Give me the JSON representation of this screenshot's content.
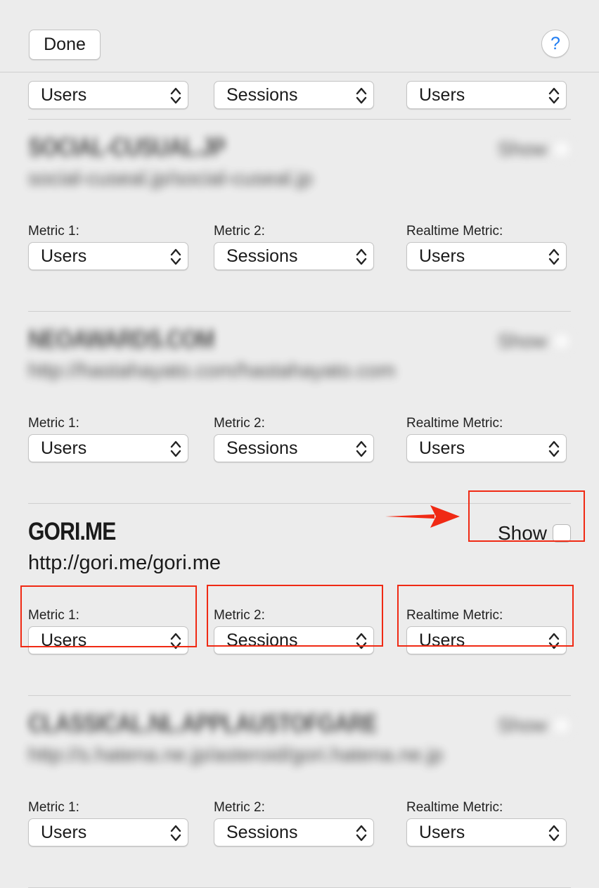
{
  "toolbar": {
    "done_label": "Done",
    "help_label": "?"
  },
  "first_row": {
    "metric1": "Users",
    "metric2": "Sessions",
    "realtime": "Users"
  },
  "labels": {
    "metric1": "Metric 1:",
    "metric2": "Metric 2:",
    "realtime": "Realtime Metric:",
    "show": "Show"
  },
  "sites": [
    {
      "name": "SOCIAL-CUSUAL.JP",
      "url": "social-cuseal.jp/social-cuseal.jp",
      "blurred": true,
      "metric1": "Users",
      "metric2": "Sessions",
      "realtime": "Users",
      "show_checked": false
    },
    {
      "name": "NEOAWARDS.COM",
      "url": "http://hastahayato.com/hastahayato.com",
      "blurred": true,
      "metric1": "Users",
      "metric2": "Sessions",
      "realtime": "Users",
      "show_checked": false
    },
    {
      "name": "GORI.ME",
      "url": "http://gori.me/gori.me",
      "blurred": false,
      "metric1": "Users",
      "metric2": "Sessions",
      "realtime": "Users",
      "show_checked": false
    },
    {
      "name": "CLASSICAL.NL.APPLAUSTOFGARE",
      "url": "http://s.hatena.ne.jp/asteroid/gori.hatena.ne.jp",
      "blurred": true,
      "metric1": "Users",
      "metric2": "Sessions",
      "realtime": "Users",
      "show_checked": false
    }
  ],
  "annotation_color": "#f02a14"
}
